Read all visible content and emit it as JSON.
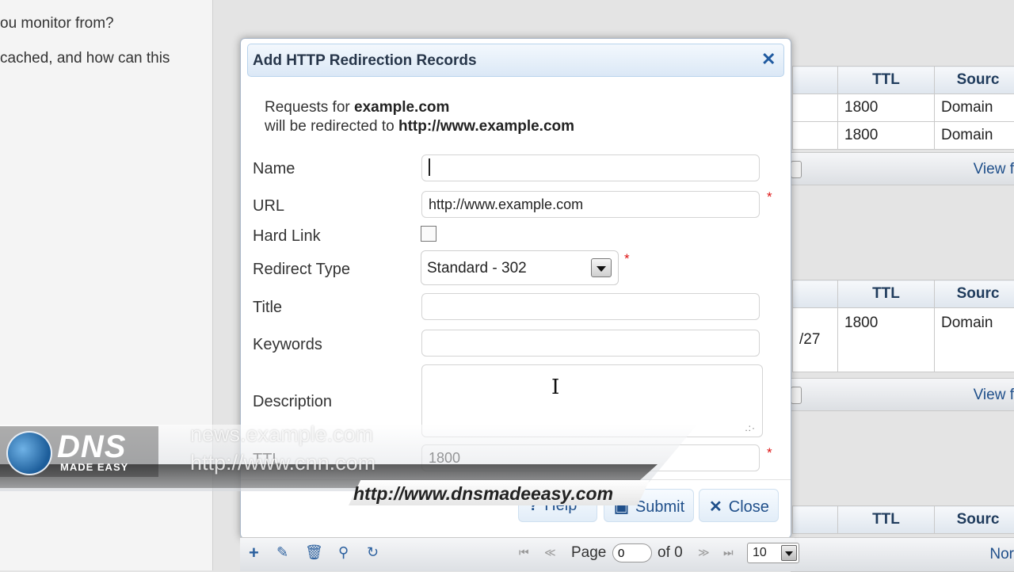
{
  "background": {
    "left_lines": [
      "ou monitor from?",
      "cached, and how can this"
    ],
    "tables": [
      {
        "headers": [
          "TTL",
          "Sourc"
        ],
        "rows": [
          [
            "1800",
            "Domain"
          ],
          [
            "1800",
            "Domain"
          ]
        ],
        "view": "View f"
      },
      {
        "headers": [
          "TTL",
          "Sourc"
        ],
        "rows": [
          [
            "1800",
            "Domain"
          ]
        ],
        "side": "/27",
        "view": "View f"
      },
      {
        "headers": [
          "TTL",
          "Sourc"
        ],
        "footer": "Nor"
      }
    ]
  },
  "dialog": {
    "title": "Add HTTP Redirection Records",
    "close_icon": "close-x-icon",
    "info": {
      "prefix1": "Requests for ",
      "domain": "example.com",
      "prefix2": "will be redirected to ",
      "target": "http://www.example.com"
    },
    "fields": {
      "name": {
        "label": "Name",
        "value": ""
      },
      "url": {
        "label": "URL",
        "value": "http://www.example.com",
        "required": "*"
      },
      "hard_link": {
        "label": "Hard Link",
        "checked": false
      },
      "redirect_type": {
        "label": "Redirect Type",
        "value": "Standard - 302",
        "required": "*"
      },
      "title": {
        "label": "Title",
        "value": ""
      },
      "keywords": {
        "label": "Keywords",
        "value": ""
      },
      "description": {
        "label": "Description",
        "value": ""
      },
      "ttl": {
        "label": "TTL",
        "value": "1800",
        "required": "*"
      }
    },
    "buttons": {
      "help": "Help",
      "submit": "Submit",
      "close": "Close"
    }
  },
  "pager": {
    "page_label": "Page",
    "page_value": "0",
    "of_label": "of 0",
    "rows_per_page": "10",
    "icons": [
      "add-icon",
      "edit-icon",
      "delete-icon",
      "search-icon",
      "refresh-icon"
    ]
  },
  "watermark": {
    "logo_name": "DNS",
    "logo_sub": "MADE EASY",
    "line1": "news.example.com",
    "line2": "http://www.cnn.com",
    "url": "http://www.dnsmadeeasy.com"
  }
}
